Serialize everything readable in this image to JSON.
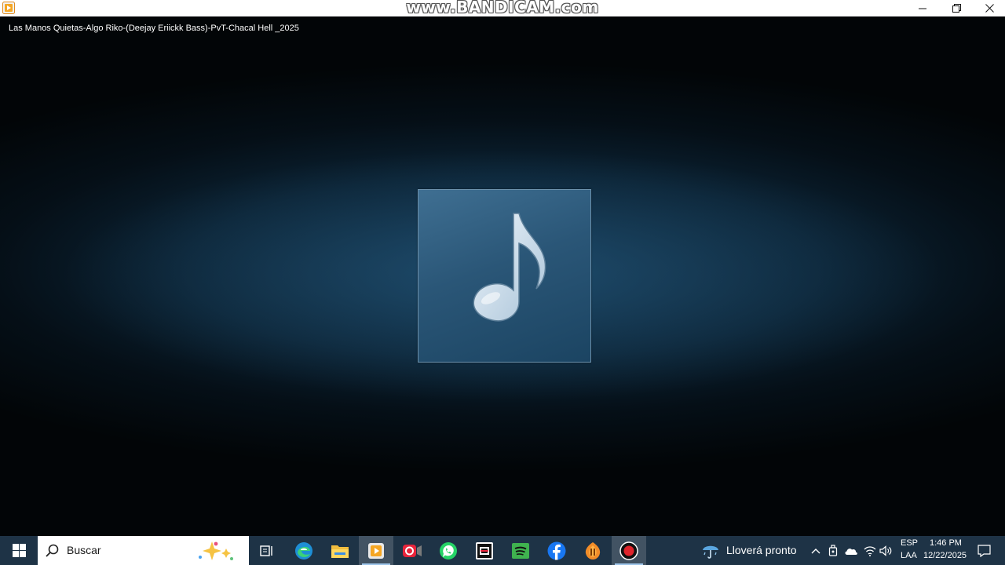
{
  "window": {
    "title": "Las Manos Quietas-Algo Riko-(Deejay Eriickk Bass)-PvT-Chacal Hell _2025",
    "watermark": "www.BANDICAM.com",
    "controls": {
      "minimize": "minimize-icon",
      "restore": "restore-icon",
      "close": "close-icon"
    }
  },
  "player": {
    "album_art_icon": "music-note-icon"
  },
  "taskbar": {
    "search_placeholder": "Buscar",
    "apps": [
      "start-icon",
      "task-view-icon",
      "edge-icon",
      "file-explorer-icon",
      "media-player-icon",
      "camera-app-icon",
      "whatsapp-icon",
      "capcut-icon",
      "spotify-icon",
      "facebook-icon",
      "fl-studio-icon",
      "bandicam-record-icon"
    ],
    "weather": "Lloverá pronto",
    "language_top": "ESP",
    "language_bottom": "LAA",
    "time": "1:46 PM",
    "date": "12/22/2025"
  },
  "colors": {
    "taskbar": "#1e3346",
    "accent": "#9ec5ea",
    "stage_dark": "#020507",
    "stage_mid": "#12344c"
  }
}
